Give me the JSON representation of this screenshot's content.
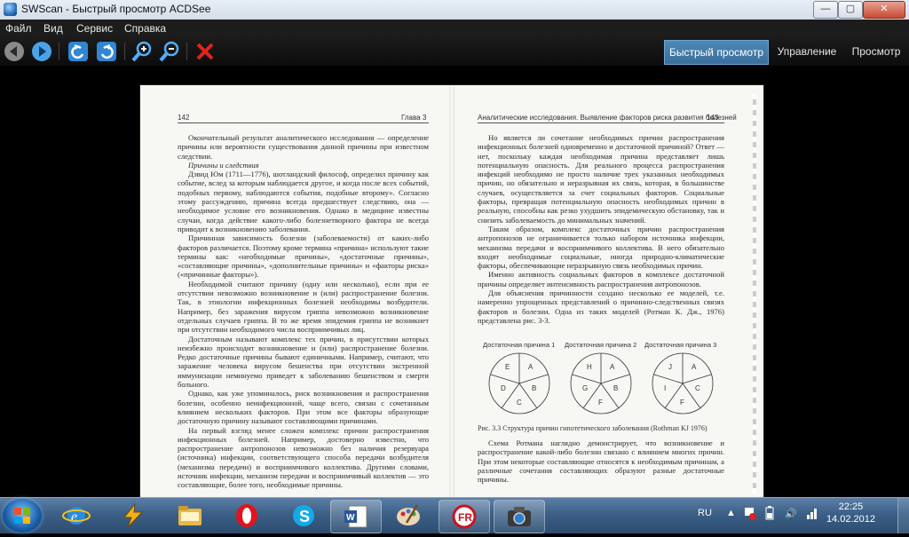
{
  "window": {
    "title": "SWScan - Быстрый просмотр ACDSee",
    "minimize": "—",
    "maximize": "▢",
    "close": "✕"
  },
  "menu": [
    "Файл",
    "Вид",
    "Сервис",
    "Справка"
  ],
  "modes": {
    "quick_view": "Быстрый просмотр",
    "manage": "Управление",
    "view": "Просмотр"
  },
  "page": {
    "left_number": "142",
    "left_chapter": "Глава 3",
    "right_header": "Аналитические исследования. Выявление факторов риска развития болезней",
    "right_number": "143",
    "left_p1": "Окончательный результат аналитического исследования — определение причины или вероятности существования данной причины при известном следствии.",
    "left_subhead": "Причины и следствия",
    "left_p2": "Дэвид Юм (1711—1776), шотландский философ, определил причину как событие, вслед за которым наблюдается другое, и когда после всех событий, подобных первому, наблюдаются события, подобные второму». Согласно этому рассуждению, причина всегда предшествует следствию, она — необходимое условие его возникновения. Однако в медицине известны случаи, когда действие какого-либо болезнетворного фактора не всегда приводит к возникновению заболевания.",
    "left_p3": "Причинная зависимость болезни (заболеваемости) от каких-либо факторов различается. Поэтому кроме термина «причина» используют такие термины как: «необходимые причины», «достаточные причины», «составляющие причины», «дополнительные причины» и «факторы риска» («причинные факторы»).",
    "left_p4": "Необходимой считают причину (одну или несколько), если при ее отсутствии невозможно возникновение и (или) распространение болезни. Так, в этиологии инфекционных болезней необходимы возбудители. Например, без заражения вирусом гриппа невозможно возникновение отдельных случаев гриппа. В то же время эпидемия гриппа не возникнет при отсутствии необходимого числа восприимчивых лиц.",
    "left_p5": "Достаточным называют комплекс тех причин, в присутствии которых неизбежно происходит возникновение и (или) распространение болезни. Редко достаточные причины бывают единичными. Например, считают, что заражение человека вирусом бешенства при отсутствии экстренной иммунизации неминуемо приведет к заболеванию бешенством и смерти больного.",
    "left_p6": "Однако, как уже упоминалось, риск возникновения и распространения болезни, особенно неинфекционной, чаще всего, связан с сочетанным влиянием нескольких факторов. При этом все факторы образующие достаточную причину называют составляющими причинами.",
    "left_p7": "На первый взгляд менее сложен комплекс причин распространения инфекционных болезней. Например, достоверно известно, что распространение антропонозов невозможно без наличия резервуара (источника) инфекции, соответствующего способа передачи возбудителя (механизма передачи) и восприимчивого коллектива. Другими словами, источник инфекции, механизм передачи и восприимчивый коллектив — это составляющие, более того, необходимые причины.",
    "right_p1": "Но является ли сочетание необходимых причин распространения инфекционных болезней одновременно и достаточной причиной? Ответ — нет, поскольку каждая необходимая причина представляет лишь потенциальную опасность. Для реального процесса распространения инфекций необходимо не просто наличие трех указанных необходимых причин, но обязательно и неразрывная их связь, которая, в большинстве случаев, осуществляется за счет социальных факторов. Социальные факторы, превращая потенциальную опасность необходимых причин в реальную, способны как резко ухудшить эпидемическую обстановку, так и снизить заболеваемость до минимальных значений.",
    "right_p2": "Таким образом, комплекс достаточных причин распространения антропонозов не ограничивается только набором источника инфекции, механизма передачи и восприимчивого коллектива. В него обязательно входят необходимые социальные, иногда природно-климатические факторы, обеспечивающие неразрывную связь необходимых причин.",
    "right_p3": "Именно активность социальных факторов в комплексе достаточной причины определяет интенсивность распространения антропонозов.",
    "right_p4": "Для объяснения причинности создано несколько ее моделей, т.е. намеренно упрощенных представлений о причинно-следственных связях факторов и болезни. Одна из таких моделей (Ротман К. Дж., 1976) представлена рис. 3-3.",
    "fig_label_1": "Достаточная причина 1",
    "fig_label_2": "Достаточная причина 2",
    "fig_label_3": "Достаточная причина 3",
    "pie1": [
      "A",
      "B",
      "C",
      "D",
      "E"
    ],
    "pie2": [
      "A",
      "B",
      "F",
      "G",
      "H"
    ],
    "pie3": [
      "A",
      "C",
      "F",
      "I",
      "J"
    ],
    "fig_caption": "Рис. 3.3 Структура причин гипотетического заболевания (Rothman KJ 1976)",
    "right_p5": "Схема Ротмана наглядно демонстрирует, что возникновение и распространение какой-либо болезни связано с влиянием многих причин. При этом некоторые составляющие относятся к необходимым причинам, а различные сочетания составляющих образуют разные достаточные причины."
  },
  "taskbar": {
    "language": "RU",
    "time": "22:25",
    "date": "14.02.2012"
  }
}
